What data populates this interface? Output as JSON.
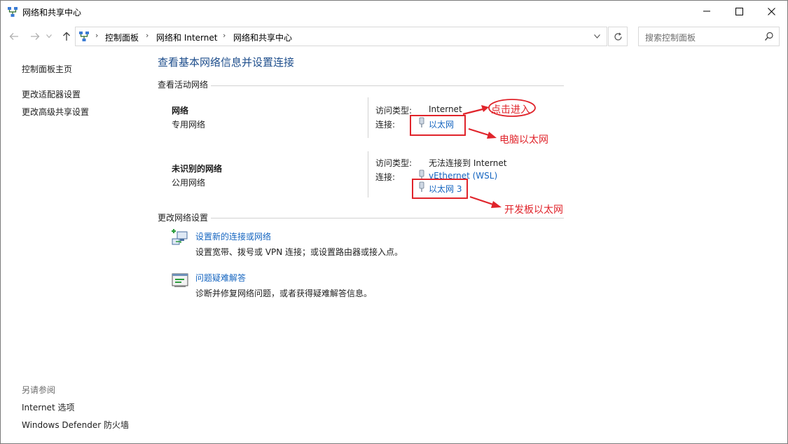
{
  "window": {
    "title": "网络和共享中心"
  },
  "address_bar": {
    "crumbs": [
      "控制面板",
      "网络和 Internet",
      "网络和共享中心"
    ]
  },
  "search": {
    "placeholder": "搜索控制面板"
  },
  "sidebar": {
    "items": [
      "控制面板主页",
      "更改适配器设置",
      "更改高级共享设置"
    ],
    "see_also_title": "另请参阅",
    "see_also": [
      "Internet 选项",
      "Windows Defender 防火墙"
    ]
  },
  "main": {
    "heading": "查看基本网络信息并设置连接",
    "active_networks_title": "查看活动网络",
    "networks": [
      {
        "name": "网络",
        "profile": "专用网络",
        "access_label": "访问类型:",
        "access_value": "Internet",
        "conn_label": "连接:",
        "connections": [
          "以太网"
        ]
      },
      {
        "name": "未识别的网络",
        "profile": "公用网络",
        "access_label": "访问类型:",
        "access_value": "无法连接到 Internet",
        "conn_label": "连接:",
        "connections": [
          "vEthernet (WSL)",
          "以太网 3"
        ]
      }
    ],
    "change_settings_title": "更改网络设置",
    "tasks": [
      {
        "link": "设置新的连接或网络",
        "desc": "设置宽带、拨号或 VPN 连接；或设置路由器或接入点。",
        "icon": "new-connection-icon"
      },
      {
        "link": "问题疑难解答",
        "desc": "诊断并修复网络问题，或者获得疑难解答信息。",
        "icon": "troubleshoot-icon"
      }
    ]
  },
  "annotations": {
    "click_enter": "点击进入",
    "pc_ethernet": "电脑以太网",
    "board_ethernet": "开发板以太网"
  },
  "colors": {
    "link": "#1565c0",
    "heading": "#1e4e8c",
    "annotation_red": "#e0242b"
  }
}
